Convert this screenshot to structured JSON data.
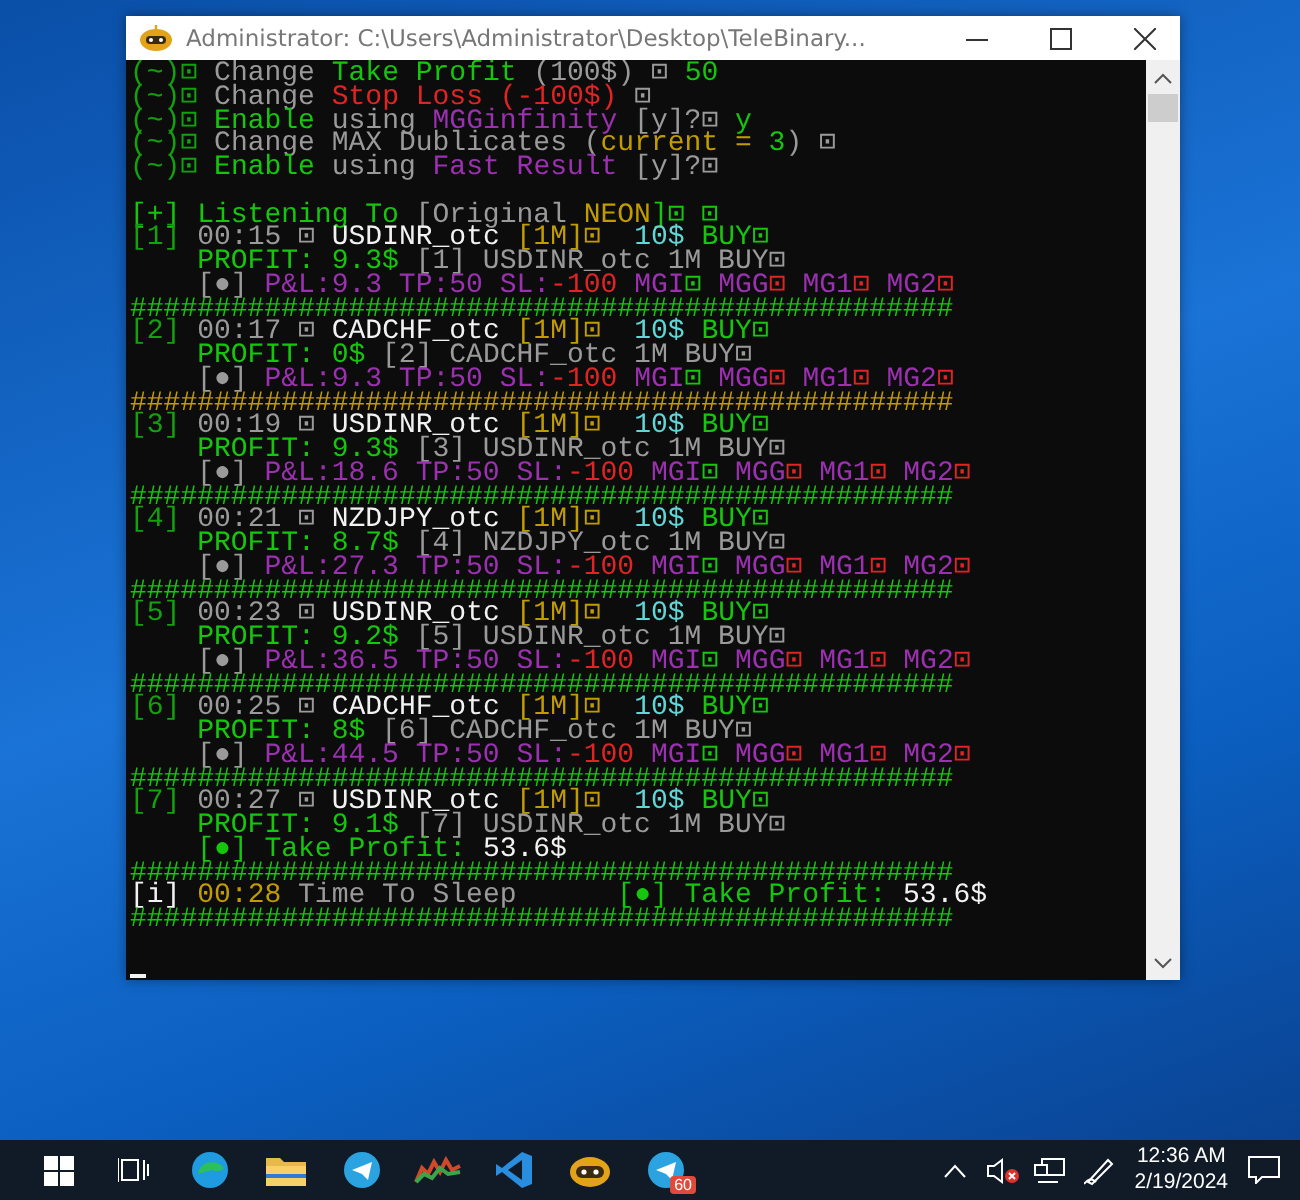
{
  "window": {
    "title": "Administrator: C:\\Users\\Administrator\\Desktop\\TeleBinary..."
  },
  "console": {
    "lines": [
      {
        "segments": [
          {
            "text": "(~)⊡ ",
            "color": "#13a10e"
          },
          {
            "text": "Change ",
            "color": "#9a9a9a"
          },
          {
            "text": "Take Profit",
            "color": "#16c60c"
          },
          {
            "text": " (100$) ⊡ ",
            "color": "#9a9a9a"
          },
          {
            "text": "50",
            "color": "#16c60c"
          }
        ]
      },
      {
        "segments": [
          {
            "text": "(~)⊡ ",
            "color": "#13a10e"
          },
          {
            "text": "Change ",
            "color": "#9a9a9a"
          },
          {
            "text": "Stop Loss (-100$)",
            "color": "#e02424"
          },
          {
            "text": " ⊡",
            "color": "#9a9a9a"
          }
        ]
      },
      {
        "segments": [
          {
            "text": "(~)⊡ ",
            "color": "#13a10e"
          },
          {
            "text": "Enable ",
            "color": "#16c60c"
          },
          {
            "text": "using ",
            "color": "#9a9a9a"
          },
          {
            "text": "MGGinfinity",
            "color": "#9b30b0"
          },
          {
            "text": " [y]?⊡ ",
            "color": "#9a9a9a"
          },
          {
            "text": "y",
            "color": "#16c60c"
          }
        ]
      },
      {
        "segments": [
          {
            "text": "(~)⊡ ",
            "color": "#13a10e"
          },
          {
            "text": "Change MAX Dublicates (",
            "color": "#9a9a9a"
          },
          {
            "text": "current = ",
            "color": "#c19c00"
          },
          {
            "text": "3",
            "color": "#16c60c"
          },
          {
            "text": ") ⊡",
            "color": "#9a9a9a"
          }
        ]
      },
      {
        "segments": [
          {
            "text": "(~)⊡ ",
            "color": "#13a10e"
          },
          {
            "text": "Enable ",
            "color": "#16c60c"
          },
          {
            "text": "using ",
            "color": "#9a9a9a"
          },
          {
            "text": "Fast Result",
            "color": "#9b30b0"
          },
          {
            "text": " [y]?⊡",
            "color": "#9a9a9a"
          }
        ]
      },
      {
        "space_before": true,
        "segments": [
          {
            "text": "[+] Listening To ",
            "color": "#16c60c"
          },
          {
            "text": "[Original ",
            "color": "#9a9a9a"
          },
          {
            "text": "NEON",
            "color": "#c19c00"
          },
          {
            "text": "]⊡ ⊡",
            "color": "#16c60c"
          }
        ]
      },
      {
        "segments": [
          {
            "text": "[1] ",
            "color": "#13a10e"
          },
          {
            "text": "00:15 ⊡ ",
            "color": "#9a9a9a"
          },
          {
            "text": "USDINR_otc ",
            "color": "#f2f2f2"
          },
          {
            "text": "[1M]⊡  ",
            "color": "#c19c00"
          },
          {
            "text": "10$ ",
            "color": "#61d6d6"
          },
          {
            "text": "BUY⊡",
            "color": "#16c60c"
          }
        ]
      },
      {
        "segments": [
          {
            "text": "    PROFIT: 9.3$ ",
            "color": "#16c60c"
          },
          {
            "text": "[1] USDINR_otc 1M BUY⊡",
            "color": "#9a9a9a"
          }
        ]
      },
      {
        "segments": [
          {
            "text": "    [●] ",
            "color": "#9a9a9a"
          },
          {
            "text": "P&L:9.3 TP:50 SL:",
            "color": "#9b30b0"
          },
          {
            "text": "-100 ",
            "color": "#e02424"
          },
          {
            "text": "MGI",
            "color": "#9b30b0"
          },
          {
            "text": "⊡ ",
            "color": "#16c60c"
          },
          {
            "text": "MGG",
            "color": "#9b30b0"
          },
          {
            "text": "⊡ ",
            "color": "#e02424"
          },
          {
            "text": "MG1",
            "color": "#9b30b0"
          },
          {
            "text": "⊡ ",
            "color": "#e02424"
          },
          {
            "text": "MG2",
            "color": "#9b30b0"
          },
          {
            "text": "⊡",
            "color": "#e02424"
          }
        ]
      },
      {
        "segments": [
          {
            "text": "#################################################",
            "color": "#16c60c"
          }
        ]
      },
      {
        "segments": [
          {
            "text": "[2] ",
            "color": "#13a10e"
          },
          {
            "text": "00:17 ⊡ ",
            "color": "#9a9a9a"
          },
          {
            "text": "CADCHF_otc ",
            "color": "#f2f2f2"
          },
          {
            "text": "[1M]⊡  ",
            "color": "#c19c00"
          },
          {
            "text": "10$ ",
            "color": "#61d6d6"
          },
          {
            "text": "BUY⊡",
            "color": "#16c60c"
          }
        ]
      },
      {
        "segments": [
          {
            "text": "    PROFIT: 0$ ",
            "color": "#16c60c"
          },
          {
            "text": "[2] CADCHF_otc 1M BUY⊡",
            "color": "#9a9a9a"
          }
        ]
      },
      {
        "segments": [
          {
            "text": "    [●] ",
            "color": "#9a9a9a"
          },
          {
            "text": "P&L:9.3 TP:50 SL:",
            "color": "#9b30b0"
          },
          {
            "text": "-100 ",
            "color": "#e02424"
          },
          {
            "text": "MGI",
            "color": "#9b30b0"
          },
          {
            "text": "⊡ ",
            "color": "#16c60c"
          },
          {
            "text": "MGG",
            "color": "#9b30b0"
          },
          {
            "text": "⊡ ",
            "color": "#e02424"
          },
          {
            "text": "MG1",
            "color": "#9b30b0"
          },
          {
            "text": "⊡ ",
            "color": "#e02424"
          },
          {
            "text": "MG2",
            "color": "#9b30b0"
          },
          {
            "text": "⊡",
            "color": "#e02424"
          }
        ]
      },
      {
        "segments": [
          {
            "text": "#################################################",
            "color": "#c19c00"
          }
        ]
      },
      {
        "segments": [
          {
            "text": "[3] ",
            "color": "#13a10e"
          },
          {
            "text": "00:19 ⊡ ",
            "color": "#9a9a9a"
          },
          {
            "text": "USDINR_otc ",
            "color": "#f2f2f2"
          },
          {
            "text": "[1M]⊡  ",
            "color": "#c19c00"
          },
          {
            "text": "10$ ",
            "color": "#61d6d6"
          },
          {
            "text": "BUY⊡",
            "color": "#16c60c"
          }
        ]
      },
      {
        "segments": [
          {
            "text": "    PROFIT: 9.3$ ",
            "color": "#16c60c"
          },
          {
            "text": "[3] USDINR_otc 1M BUY⊡",
            "color": "#9a9a9a"
          }
        ]
      },
      {
        "segments": [
          {
            "text": "    [●] ",
            "color": "#9a9a9a"
          },
          {
            "text": "P&L:18.6 TP:50 SL:",
            "color": "#9b30b0"
          },
          {
            "text": "-100 ",
            "color": "#e02424"
          },
          {
            "text": "MGI",
            "color": "#9b30b0"
          },
          {
            "text": "⊡ ",
            "color": "#16c60c"
          },
          {
            "text": "MGG",
            "color": "#9b30b0"
          },
          {
            "text": "⊡ ",
            "color": "#e02424"
          },
          {
            "text": "MG1",
            "color": "#9b30b0"
          },
          {
            "text": "⊡ ",
            "color": "#e02424"
          },
          {
            "text": "MG2",
            "color": "#9b30b0"
          },
          {
            "text": "⊡",
            "color": "#e02424"
          }
        ]
      },
      {
        "segments": [
          {
            "text": "#################################################",
            "color": "#16c60c"
          }
        ]
      },
      {
        "segments": [
          {
            "text": "[4] ",
            "color": "#13a10e"
          },
          {
            "text": "00:21 ⊡ ",
            "color": "#9a9a9a"
          },
          {
            "text": "NZDJPY_otc ",
            "color": "#f2f2f2"
          },
          {
            "text": "[1M]⊡  ",
            "color": "#c19c00"
          },
          {
            "text": "10$ ",
            "color": "#61d6d6"
          },
          {
            "text": "BUY⊡",
            "color": "#16c60c"
          }
        ]
      },
      {
        "segments": [
          {
            "text": "    PROFIT: 8.7$ ",
            "color": "#16c60c"
          },
          {
            "text": "[4] NZDJPY_otc 1M BUY⊡",
            "color": "#9a9a9a"
          }
        ]
      },
      {
        "segments": [
          {
            "text": "    [●] ",
            "color": "#9a9a9a"
          },
          {
            "text": "P&L:27.3 TP:50 SL:",
            "color": "#9b30b0"
          },
          {
            "text": "-100 ",
            "color": "#e02424"
          },
          {
            "text": "MGI",
            "color": "#9b30b0"
          },
          {
            "text": "⊡ ",
            "color": "#16c60c"
          },
          {
            "text": "MGG",
            "color": "#9b30b0"
          },
          {
            "text": "⊡ ",
            "color": "#e02424"
          },
          {
            "text": "MG1",
            "color": "#9b30b0"
          },
          {
            "text": "⊡ ",
            "color": "#e02424"
          },
          {
            "text": "MG2",
            "color": "#9b30b0"
          },
          {
            "text": "⊡",
            "color": "#e02424"
          }
        ]
      },
      {
        "segments": [
          {
            "text": "#################################################",
            "color": "#16c60c"
          }
        ]
      },
      {
        "segments": [
          {
            "text": "[5] ",
            "color": "#13a10e"
          },
          {
            "text": "00:23 ⊡ ",
            "color": "#9a9a9a"
          },
          {
            "text": "USDINR_otc ",
            "color": "#f2f2f2"
          },
          {
            "text": "[1M]⊡  ",
            "color": "#c19c00"
          },
          {
            "text": "10$ ",
            "color": "#61d6d6"
          },
          {
            "text": "BUY⊡",
            "color": "#16c60c"
          }
        ]
      },
      {
        "segments": [
          {
            "text": "    PROFIT: 9.2$ ",
            "color": "#16c60c"
          },
          {
            "text": "[5] USDINR_otc 1M BUY⊡",
            "color": "#9a9a9a"
          }
        ]
      },
      {
        "segments": [
          {
            "text": "    [●] ",
            "color": "#9a9a9a"
          },
          {
            "text": "P&L:36.5 TP:50 SL:",
            "color": "#9b30b0"
          },
          {
            "text": "-100 ",
            "color": "#e02424"
          },
          {
            "text": "MGI",
            "color": "#9b30b0"
          },
          {
            "text": "⊡ ",
            "color": "#16c60c"
          },
          {
            "text": "MGG",
            "color": "#9b30b0"
          },
          {
            "text": "⊡ ",
            "color": "#e02424"
          },
          {
            "text": "MG1",
            "color": "#9b30b0"
          },
          {
            "text": "⊡ ",
            "color": "#e02424"
          },
          {
            "text": "MG2",
            "color": "#9b30b0"
          },
          {
            "text": "⊡",
            "color": "#e02424"
          }
        ]
      },
      {
        "segments": [
          {
            "text": "#################################################",
            "color": "#16c60c"
          }
        ]
      },
      {
        "segments": [
          {
            "text": "[6] ",
            "color": "#13a10e"
          },
          {
            "text": "00:25 ⊡ ",
            "color": "#9a9a9a"
          },
          {
            "text": "CADCHF_otc ",
            "color": "#f2f2f2"
          },
          {
            "text": "[1M]⊡  ",
            "color": "#c19c00"
          },
          {
            "text": "10$ ",
            "color": "#61d6d6"
          },
          {
            "text": "BUY⊡",
            "color": "#16c60c"
          }
        ]
      },
      {
        "segments": [
          {
            "text": "    PROFIT: 8$ ",
            "color": "#16c60c"
          },
          {
            "text": "[6] CADCHF_otc 1M BUY⊡",
            "color": "#9a9a9a"
          }
        ]
      },
      {
        "segments": [
          {
            "text": "    [●] ",
            "color": "#9a9a9a"
          },
          {
            "text": "P&L:44.5 TP:50 SL:",
            "color": "#9b30b0"
          },
          {
            "text": "-100 ",
            "color": "#e02424"
          },
          {
            "text": "MGI",
            "color": "#9b30b0"
          },
          {
            "text": "⊡ ",
            "color": "#16c60c"
          },
          {
            "text": "MGG",
            "color": "#9b30b0"
          },
          {
            "text": "⊡ ",
            "color": "#e02424"
          },
          {
            "text": "MG1",
            "color": "#9b30b0"
          },
          {
            "text": "⊡ ",
            "color": "#e02424"
          },
          {
            "text": "MG2",
            "color": "#9b30b0"
          },
          {
            "text": "⊡",
            "color": "#e02424"
          }
        ]
      },
      {
        "segments": [
          {
            "text": "#################################################",
            "color": "#16c60c"
          }
        ]
      },
      {
        "segments": [
          {
            "text": "[7] ",
            "color": "#13a10e"
          },
          {
            "text": "00:27 ⊡ ",
            "color": "#9a9a9a"
          },
          {
            "text": "USDINR_otc ",
            "color": "#f2f2f2"
          },
          {
            "text": "[1M]⊡  ",
            "color": "#c19c00"
          },
          {
            "text": "10$ ",
            "color": "#61d6d6"
          },
          {
            "text": "BUY⊡",
            "color": "#16c60c"
          }
        ]
      },
      {
        "segments": [
          {
            "text": "    PROFIT: 9.1$ ",
            "color": "#16c60c"
          },
          {
            "text": "[7] USDINR_otc 1M BUY⊡",
            "color": "#9a9a9a"
          }
        ]
      },
      {
        "segments": [
          {
            "text": "    [●] Take Profit: ",
            "color": "#16c60c"
          },
          {
            "text": "53.6$",
            "color": "#f2f2f2"
          }
        ]
      },
      {
        "segments": [
          {
            "text": "#################################################",
            "color": "#16c60c"
          }
        ]
      },
      {
        "segments": [
          {
            "text": "[i] ",
            "color": "#f2f2f2"
          },
          {
            "text": "00:28 ",
            "color": "#c19c00"
          },
          {
            "text": "Time To Sleep      ",
            "color": "#9a9a9a"
          },
          {
            "text": "[●] Take Profit: ",
            "color": "#16c60c"
          },
          {
            "text": "53.6$",
            "color": "#f2f2f2"
          }
        ]
      },
      {
        "segments": [
          {
            "text": "#################################################",
            "color": "#16c60c"
          }
        ]
      }
    ]
  },
  "taskbar": {
    "badge": "60",
    "clock": {
      "time": "12:36 AM",
      "date": "2/19/2024"
    }
  }
}
